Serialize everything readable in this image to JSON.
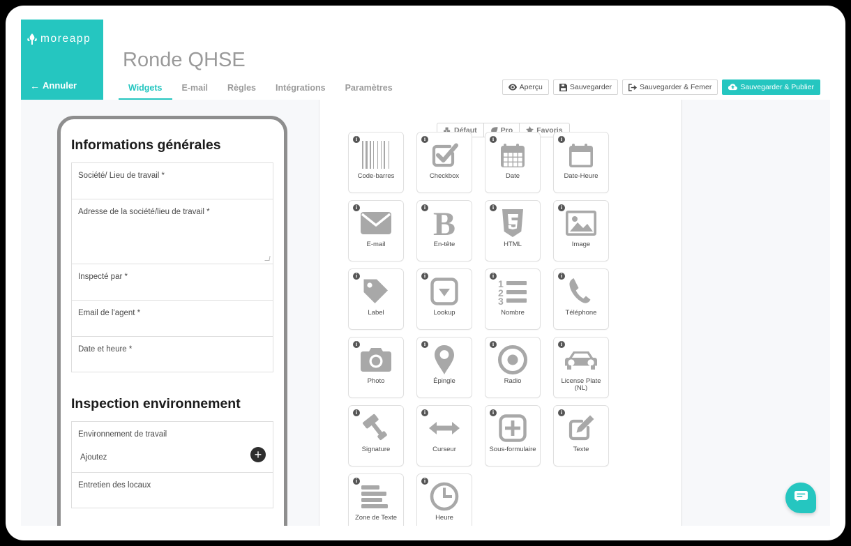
{
  "brand": {
    "name": "moreapp",
    "logo_icon": "leaf-icon",
    "color": "#25c6c0"
  },
  "header": {
    "cancel_label": "Annuler",
    "form_title": "Ronde QHSE"
  },
  "tabs": [
    {
      "label": "Widgets",
      "active": true
    },
    {
      "label": "E-mail",
      "active": false
    },
    {
      "label": "Règles",
      "active": false
    },
    {
      "label": "Intégrations",
      "active": false
    },
    {
      "label": "Paramètres",
      "active": false
    }
  ],
  "toolbar": [
    {
      "label": "Aperçu",
      "icon": "eye-icon",
      "primary": false
    },
    {
      "label": "Sauvegarder",
      "icon": "floppy-icon",
      "primary": false
    },
    {
      "label": "Sauvegarder & Femer",
      "icon": "exit-icon",
      "primary": false
    },
    {
      "label": "Sauvegarder & Publier",
      "icon": "cloud-upload-icon",
      "primary": true
    }
  ],
  "filters": [
    {
      "label": "Défaut",
      "icon": "cubes-icon",
      "active": true
    },
    {
      "label": "Pro",
      "icon": "leaf-icon",
      "active": false
    },
    {
      "label": "Favoris",
      "icon": "star-icon",
      "active": false
    }
  ],
  "form_preview": {
    "sections": [
      {
        "title": "Informations générales",
        "fields": [
          {
            "label": "Société/ Lieu de travail *",
            "size": "sm"
          },
          {
            "label": "Adresse de la société/lieu de travail *",
            "size": "lg"
          },
          {
            "label": "Inspecté par *",
            "size": "sm"
          },
          {
            "label": "Email de l'agent *",
            "size": "sm"
          },
          {
            "label": "Date et heure *",
            "size": "sm"
          }
        ]
      },
      {
        "title": "Inspection environnement",
        "fields": [
          {
            "label": "Environnement de travail",
            "size": "add",
            "add_label": "Ajoutez",
            "add_icon": "plus-icon"
          },
          {
            "label": "Entretien des locaux",
            "size": "sm"
          }
        ]
      }
    ]
  },
  "widgets": [
    {
      "label": "Code-barres",
      "icon": "barcode-icon"
    },
    {
      "label": "Checkbox",
      "icon": "checkbox-icon"
    },
    {
      "label": "Date",
      "icon": "calendar-icon"
    },
    {
      "label": "Date-Heure",
      "icon": "calendar-blank-icon"
    },
    {
      "label": "E-mail",
      "icon": "envelope-icon"
    },
    {
      "label": "En-tête",
      "icon": "bold-b-icon"
    },
    {
      "label": "HTML",
      "icon": "html5-icon"
    },
    {
      "label": "Image",
      "icon": "image-icon"
    },
    {
      "label": "Label",
      "icon": "tag-icon"
    },
    {
      "label": "Lookup",
      "icon": "dropdown-icon"
    },
    {
      "label": "Nombre",
      "icon": "ordered-list-icon"
    },
    {
      "label": "Téléphone",
      "icon": "phone-icon"
    },
    {
      "label": "Photo",
      "icon": "camera-icon"
    },
    {
      "label": "Épingle",
      "icon": "map-pin-icon"
    },
    {
      "label": "Radio",
      "icon": "radio-button-icon"
    },
    {
      "label": "License Plate (NL)",
      "icon": "car-icon"
    },
    {
      "label": "Signature",
      "icon": "gavel-icon"
    },
    {
      "label": "Curseur",
      "icon": "arrows-horizontal-icon"
    },
    {
      "label": "Sous-formulaire",
      "icon": "plus-square-icon"
    },
    {
      "label": "Texte",
      "icon": "pencil-square-icon"
    },
    {
      "label": "Zone de Texte",
      "icon": "text-lines-icon"
    },
    {
      "label": "Heure",
      "icon": "clock-icon"
    }
  ],
  "widget_info_glyph": "i",
  "chat": {
    "icon": "chat-bubble-icon"
  }
}
